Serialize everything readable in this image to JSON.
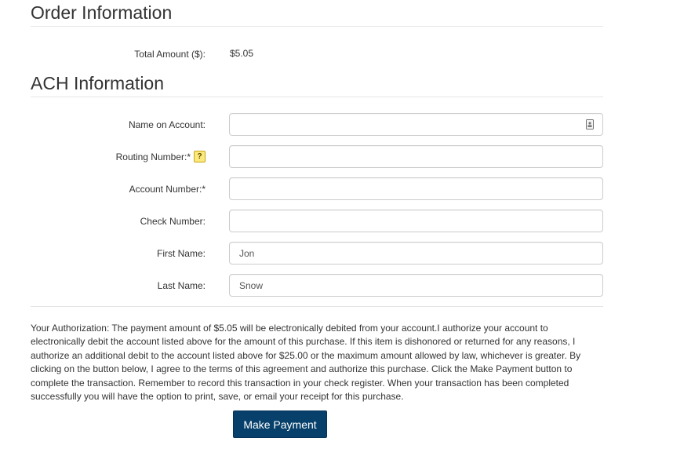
{
  "order_section": {
    "heading": "Order Information",
    "total_amount_label": "Total Amount ($):",
    "total_amount_value": "$5.05"
  },
  "ach_section": {
    "heading": "ACH Information",
    "name_on_account": {
      "label": "Name on Account:",
      "value": ""
    },
    "routing_number": {
      "label": "Routing Number:*",
      "help_icon": "?",
      "value": ""
    },
    "account_number": {
      "label": "Account Number:*",
      "value": ""
    },
    "check_number": {
      "label": "Check Number:",
      "value": ""
    },
    "first_name": {
      "label": "First Name:",
      "value": "Jon"
    },
    "last_name": {
      "label": "Last Name:",
      "value": "Snow"
    }
  },
  "authorization_text": "Your Authorization: The payment amount of $5.05 will be electronically debited from your account.I authorize your account to electronically debit the account listed above for the amount of this purchase. If this item is dishonored or returned for any reasons, I authorize an additional debit to the account listed above for $25.00 or the maximum amount allowed by law, whichever is greater. By clicking on the button below, I agree to the terms of this agreement and authorize this purchase. Click the Make Payment button to complete the transaction. Remember to record this transaction in your check register. When your transaction has been completed successfully you will have the option to print, save, or email your receipt for this purchase.",
  "make_payment_label": "Make Payment",
  "colors": {
    "button_bg": "#06406b",
    "help_icon_bg": "#fbe97e",
    "rule": "#e5e5e5"
  },
  "icons": {
    "routing_help": "question-mark-icon",
    "name_field": "contact-card-icon"
  }
}
